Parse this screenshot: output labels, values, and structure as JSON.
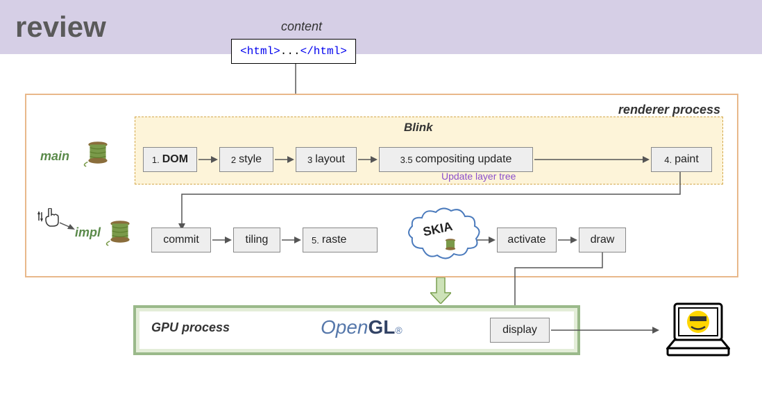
{
  "title": "review",
  "content_label": "content",
  "html_snippet": {
    "open": "<html>",
    "dots": "...",
    "close": "</html>"
  },
  "renderer_label": "renderer process",
  "blink_label": "Blink",
  "main_label": "main",
  "impl_label": "impl",
  "layer_tree_note": "Update layer tree",
  "main_stages": [
    {
      "num": "1.",
      "label": "DOM"
    },
    {
      "num": "2",
      "label": "style"
    },
    {
      "num": "3",
      "label": "layout"
    },
    {
      "num": "3.5",
      "label": "compositing update"
    },
    {
      "num": "4.",
      "label": "paint"
    }
  ],
  "impl_stages": [
    {
      "label": "commit"
    },
    {
      "label": "tiling"
    },
    {
      "num": "5.",
      "label": "raste"
    },
    {
      "label": "activate"
    },
    {
      "label": "draw"
    }
  ],
  "gpu_label": "GPU process",
  "display_label": "display",
  "skia_label": "SKIA",
  "opengl_prefix": "Open",
  "opengl_suffix": "GL"
}
